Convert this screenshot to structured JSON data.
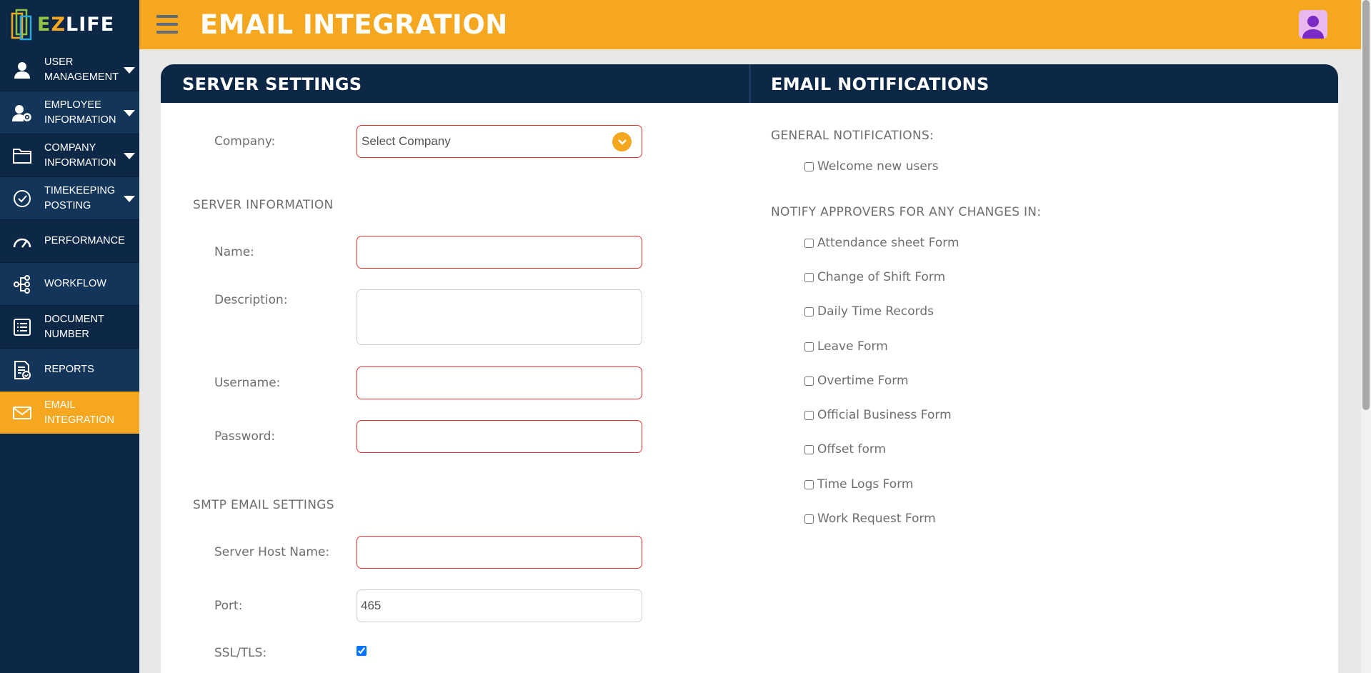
{
  "app": {
    "logo_text_e": "E",
    "logo_text_z": "Z",
    "logo_text_life": "LIFE",
    "page_title": "EMAIL INTEGRATION"
  },
  "sidebar": {
    "items": [
      {
        "label": "USER MANAGEMENT",
        "icon": "user-icon",
        "has_caret": true
      },
      {
        "label": "EMPLOYEE INFORMATION",
        "icon": "user-gear-icon",
        "has_caret": true
      },
      {
        "label": "COMPANY INFORMATION",
        "icon": "folder-icon",
        "has_caret": true
      },
      {
        "label": "TIMEKEEPING POSTING",
        "icon": "check-circle-icon",
        "has_caret": true
      },
      {
        "label": "PERFORMANCE",
        "icon": "gauge-icon",
        "has_caret": false
      },
      {
        "label": "WORKFLOW",
        "icon": "workflow-icon",
        "has_caret": false
      },
      {
        "label": "DOCUMENT NUMBER",
        "icon": "document-list-icon",
        "has_caret": false
      },
      {
        "label": "REPORTS",
        "icon": "report-icon",
        "has_caret": false
      },
      {
        "label": "EMAIL INTEGRATION",
        "icon": "envelope-icon",
        "has_caret": false,
        "active": true
      }
    ]
  },
  "server_settings": {
    "title": "SERVER SETTINGS",
    "company_label": "Company:",
    "company_value": "Select Company",
    "server_info_heading": "SERVER INFORMATION",
    "name_label": "Name:",
    "name_value": "",
    "description_label": "Description:",
    "description_value": "",
    "username_label": "Username:",
    "username_value": "",
    "password_label": "Password:",
    "password_value": "",
    "smtp_heading": "SMTP EMAIL SETTINGS",
    "host_label": "Server Host Name:",
    "host_value": "",
    "port_label": "Port:",
    "port_value": "465",
    "ssl_label": "SSL/TLS:",
    "ssl_checked": true
  },
  "email_notifications": {
    "title": "EMAIL NOTIFICATIONS",
    "general_heading": "GENERAL NOTIFICATIONS:",
    "general_items": [
      {
        "label": "Welcome new users",
        "checked": false
      }
    ],
    "approvers_heading": "NOTIFY APPROVERS FOR ANY CHANGES IN:",
    "approver_items": [
      {
        "label": "Attendance sheet Form",
        "checked": false
      },
      {
        "label": "Change of Shift Form",
        "checked": false
      },
      {
        "label": "Daily Time Records",
        "checked": false
      },
      {
        "label": "Leave Form",
        "checked": false
      },
      {
        "label": "Overtime Form",
        "checked": false
      },
      {
        "label": "Official Business Form",
        "checked": false
      },
      {
        "label": "Offset form",
        "checked": false
      },
      {
        "label": "Time Logs Form",
        "checked": false
      },
      {
        "label": "Work Request Form",
        "checked": false
      }
    ]
  },
  "colors": {
    "sidebar_bg": "#0d2847",
    "accent": "#f5a81f",
    "required_border": "#e8352f"
  }
}
